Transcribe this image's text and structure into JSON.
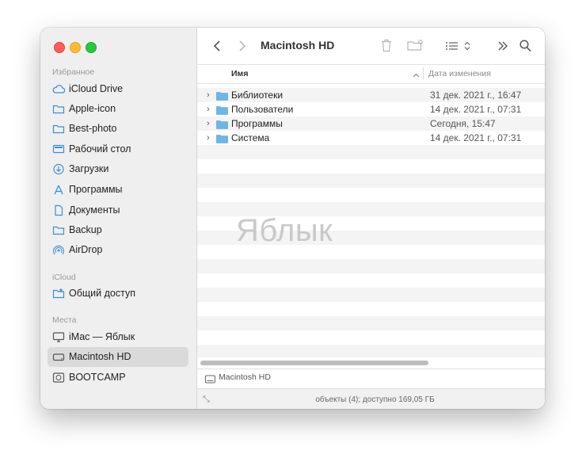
{
  "window": {
    "title": "Macintosh HD",
    "traffic_lights": {
      "close": "#ff5f57",
      "minimize": "#febc2e",
      "zoom": "#28c840"
    }
  },
  "sidebar": {
    "favorites_header": "Избранное",
    "favorites": [
      {
        "label": "iCloud Drive",
        "icon": "cloud-icon"
      },
      {
        "label": "Apple-icon",
        "icon": "folder-icon"
      },
      {
        "label": "Best-photo",
        "icon": "folder-icon"
      },
      {
        "label": "Рабочий стол",
        "icon": "desktop-icon"
      },
      {
        "label": "Загрузки",
        "icon": "download-icon"
      },
      {
        "label": "Программы",
        "icon": "applications-icon"
      },
      {
        "label": "Документы",
        "icon": "document-icon"
      },
      {
        "label": "Backup",
        "icon": "folder-icon"
      },
      {
        "label": "AirDrop",
        "icon": "airdrop-icon"
      }
    ],
    "icloud_header": "iCloud",
    "icloud": [
      {
        "label": "Общий доступ",
        "icon": "shared-folder-icon"
      }
    ],
    "locations_header": "Места",
    "locations": [
      {
        "label": "iMac — Яблык",
        "icon": "imac-icon"
      },
      {
        "label": "Macintosh HD",
        "icon": "disk-icon",
        "selected": true
      },
      {
        "label": "BOOTCAMP",
        "icon": "disk-icon"
      }
    ]
  },
  "columns": {
    "name": "Имя",
    "date": "Дата изменения"
  },
  "files": [
    {
      "name": "Библиотеки",
      "date": "31 дек. 2021 г., 16:47"
    },
    {
      "name": "Пользователи",
      "date": "14 дек. 2021 г., 07:31"
    },
    {
      "name": "Программы",
      "date": "Сегодня, 15:47"
    },
    {
      "name": "Система",
      "date": "14 дек. 2021 г., 07:31"
    }
  ],
  "watermark": "Яблык",
  "pathbar": {
    "label": "Macintosh HD"
  },
  "status": "объекты (4); доступно 169,05 ГБ",
  "accent": {
    "folder": "#6cb6e8",
    "selection": "#dadada"
  }
}
